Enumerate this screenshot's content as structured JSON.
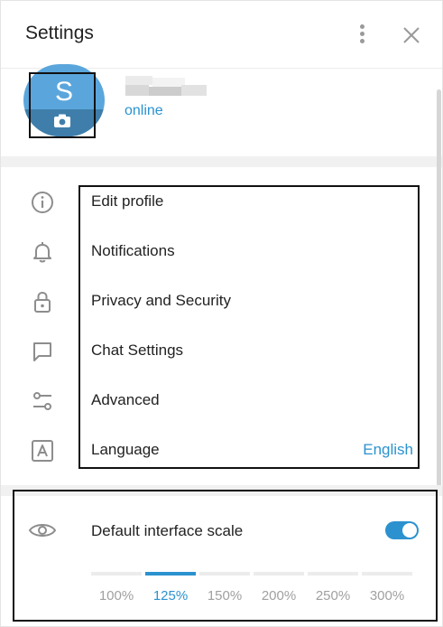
{
  "header": {
    "title": "Settings"
  },
  "profile": {
    "avatar_letter": "S",
    "status": "online",
    "avatar_color": "#5aa6dc"
  },
  "menu": {
    "items": [
      {
        "label": "Edit profile",
        "icon": "info-icon"
      },
      {
        "label": "Notifications",
        "icon": "bell-icon"
      },
      {
        "label": "Privacy and Security",
        "icon": "lock-icon"
      },
      {
        "label": "Chat Settings",
        "icon": "chat-bubble-icon"
      },
      {
        "label": "Advanced",
        "icon": "sliders-icon"
      },
      {
        "label": "Language",
        "icon": "language-icon",
        "value": "English"
      }
    ]
  },
  "scale": {
    "label": "Default interface scale",
    "enabled": true,
    "options": [
      "100%",
      "125%",
      "150%",
      "200%",
      "250%",
      "300%"
    ],
    "selected": "125%"
  },
  "colors": {
    "accent": "#2b92cf"
  }
}
